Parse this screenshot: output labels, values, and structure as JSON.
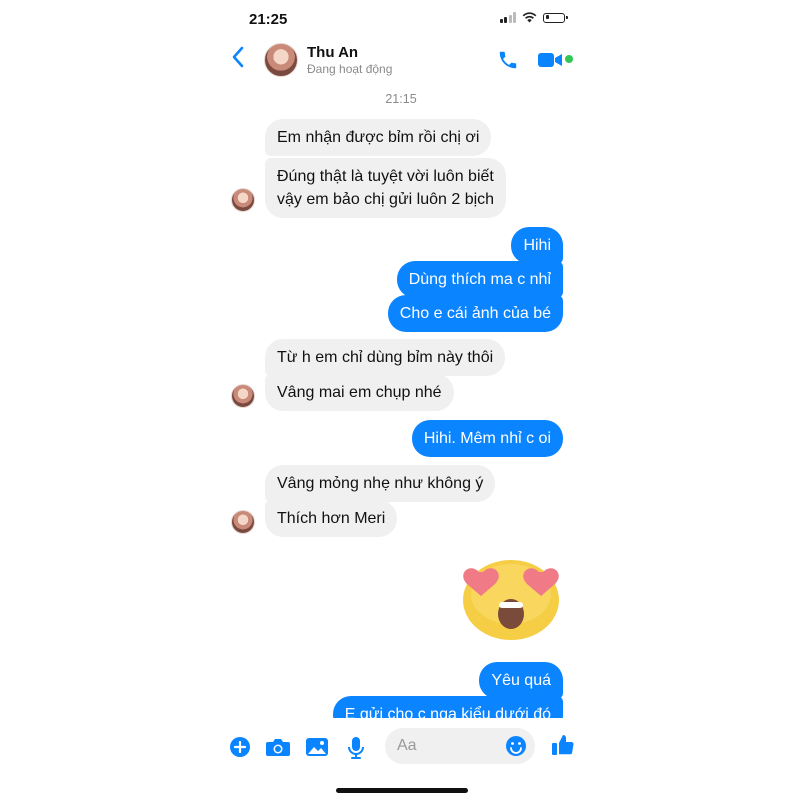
{
  "status_bar": {
    "time": "21:25"
  },
  "header": {
    "contact_name": "Thu An",
    "contact_status": "Đang hoạt động"
  },
  "chat": {
    "timestamp": "21:15",
    "messages": [
      {
        "from": "them",
        "text": "Em nhận được bỉm rồi chị ơi"
      },
      {
        "from": "them",
        "text": "Đúng thật là tuyệt vời luôn biết vậy em bảo chị gửi luôn 2 bịch",
        "lines": [
          "Đúng thật là tuyệt vời luôn biết",
          "vậy em bảo chị gửi luôn 2 bịch"
        ]
      },
      {
        "from": "me",
        "text": "Hihi"
      },
      {
        "from": "me",
        "text": "Dùng thích ma c nhỉ"
      },
      {
        "from": "me",
        "text": "Cho e cái ảnh của bé"
      },
      {
        "from": "them",
        "text": "Từ h em chỉ dùng bỉm này thôi"
      },
      {
        "from": "them",
        "text": "Vâng mai em chụp nhé"
      },
      {
        "from": "me",
        "text": "Hihi. Mêm nhỉ c oi"
      },
      {
        "from": "them",
        "text": "Vâng mỏng nhẹ như không ý"
      },
      {
        "from": "them",
        "text": "Thích hơn Meri"
      },
      {
        "from": "me",
        "type": "emoji",
        "icon": "heart-eyes-emoji-icon"
      },
      {
        "from": "me",
        "text": "Yêu quá"
      },
      {
        "from": "me",
        "text": "E gửi cho c ngạ kiểu dưới đó"
      }
    ]
  },
  "composer": {
    "placeholder": "Aa"
  },
  "colors": {
    "accent": "#0a84ff",
    "incoming_bubble": "#f0f0f0",
    "online": "#31c754"
  },
  "icons": [
    "back-icon",
    "call-icon",
    "video-icon",
    "plus-icon",
    "camera-icon",
    "image-icon",
    "mic-icon",
    "smiley-icon",
    "like-icon"
  ]
}
